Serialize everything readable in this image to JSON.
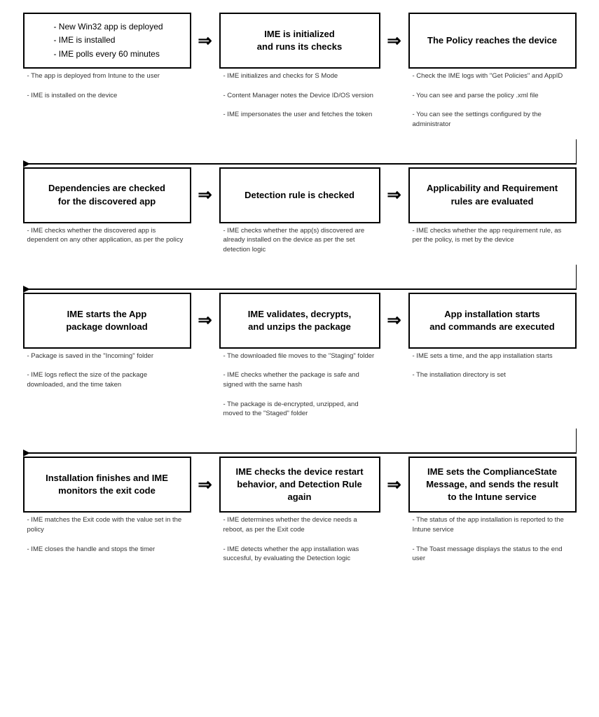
{
  "rows": [
    {
      "boxes": [
        {
          "id": "box-1",
          "title": "- New Win32 app is deployed\n- IME is installed\n- IME polls every 60 minutes",
          "bold": false,
          "notes": [
            "- The app is deployed from Intune to the user",
            "- IME is installed on the device"
          ]
        },
        {
          "id": "box-2",
          "title": "IME is initialized\nand runs its checks",
          "bold": true,
          "notes": [
            "- IME initializes and checks for S Mode",
            "- Content Manager notes the Device ID/OS version",
            "- IME impersonates the user and fetches the token"
          ]
        },
        {
          "id": "box-3",
          "title": "The Policy reaches the device",
          "bold": true,
          "notes": [
            "- Check the IME logs with \"Get Policies\" and AppID",
            "- You can see and parse the policy .xml file",
            "- You can see the settings configured by the administrator"
          ]
        }
      ]
    },
    {
      "boxes": [
        {
          "id": "box-4",
          "title": "Dependencies are checked\nfor the discovered app",
          "bold": true,
          "notes": [
            "- IME checks whether the discovered app is dependent on any other application, as per the policy"
          ]
        },
        {
          "id": "box-5",
          "title": "Detection rule is checked",
          "bold": true,
          "notes": [
            "- IME checks whether the app(s) discovered are already installed on the device as per the set detection logic"
          ]
        },
        {
          "id": "box-6",
          "title": "Applicability and Requirement\nrules are evaluated",
          "bold": true,
          "notes": [
            "- IME checks whether the app requirement rule, as per the policy, is met by the device"
          ]
        }
      ]
    },
    {
      "boxes": [
        {
          "id": "box-7",
          "title": "IME starts the App\npackage download",
          "bold": true,
          "notes": [
            "- Package is saved in the \"Incoming\" folder",
            "- IME logs reflect the size of the package downloaded, and the time taken"
          ]
        },
        {
          "id": "box-8",
          "title": "IME validates, decrypts,\nand unzips the package",
          "bold": true,
          "notes": [
            "- The downloaded file moves to the \"Staging\" folder",
            "- IME checks whether the package is safe and signed with the same hash",
            "- The package is de-encrypted, unzipped, and moved to the \"Staged\" folder"
          ]
        },
        {
          "id": "box-9",
          "title": "App installation starts\nand commands are executed",
          "bold": true,
          "notes": [
            "- IME sets a time, and the app installation starts",
            "- The installation directory is set"
          ]
        }
      ]
    },
    {
      "boxes": [
        {
          "id": "box-10",
          "title": "Installation finishes and IME\nmonitors the exit code",
          "bold": true,
          "notes": [
            "- IME matches the Exit code with the value set in the policy",
            "- IME closes the handle and stops the timer"
          ]
        },
        {
          "id": "box-11",
          "title": "IME checks the device restart\nbehavior, and Detection Rule\nagain",
          "bold": true,
          "notes": [
            "- IME determines whether the device needs a reboot, as per the Exit code",
            "- IME detects whether the app installation was succesful, by evaluating the Detection logic"
          ]
        },
        {
          "id": "box-12",
          "title": "IME sets the ComplianceState\nMessage, and sends the result\nto the Intune service",
          "bold": true,
          "notes": [
            "- The status of the app installation is reported to the Intune service",
            "- The Toast message displays the status to the end user"
          ]
        }
      ]
    }
  ],
  "arrows": {
    "right": "⇒",
    "down": "↓"
  }
}
